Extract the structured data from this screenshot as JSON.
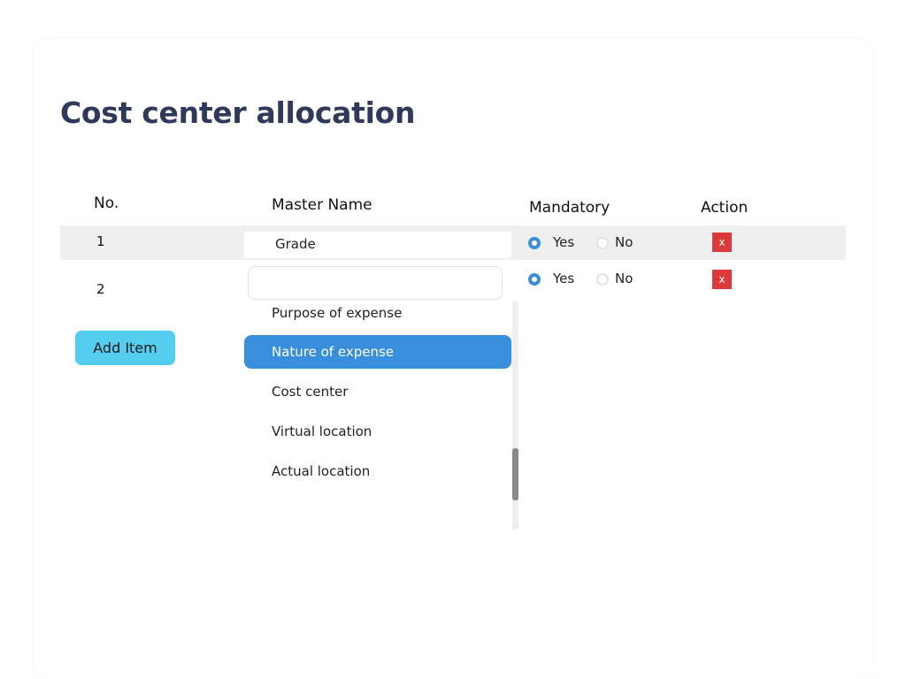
{
  "page": {
    "title": "Cost center allocation"
  },
  "table": {
    "headers": {
      "no": "No.",
      "master_name": "Master Name",
      "mandatory": "Mandatory",
      "action": "Action"
    },
    "rows": [
      {
        "no": "1",
        "master_name": "Grade",
        "mandatory": "Yes",
        "yes_label": "Yes",
        "no_label": "No",
        "delete_label": "x"
      },
      {
        "no": "2",
        "master_name": "",
        "mandatory": "Yes",
        "yes_label": "Yes",
        "no_label": "No",
        "delete_label": "x"
      }
    ]
  },
  "dropdown": {
    "search_value": "",
    "options": [
      "Purpose of expense",
      "Nature of expense",
      "Cost center",
      "Virtual location",
      "Actual location"
    ],
    "selected": "Nature of expense"
  },
  "actions": {
    "add_item_label": "Add Item"
  },
  "colors": {
    "title": "#2f3a5a",
    "accent": "#3a8fdd",
    "add_button": "#55cdee",
    "delete_button": "#dc3a3a",
    "row_band": "#efefef"
  },
  "icons": {
    "radio_selected": "radio-selected-icon",
    "radio_unselected": "radio-unselected-icon",
    "delete": "close-icon"
  }
}
